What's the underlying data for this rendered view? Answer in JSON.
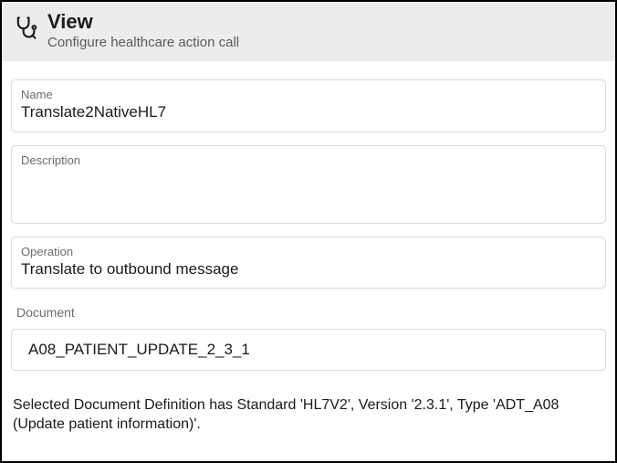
{
  "header": {
    "title": "View",
    "subtitle": "Configure healthcare action call"
  },
  "fields": {
    "name": {
      "label": "Name",
      "value": "Translate2NativeHL7"
    },
    "description": {
      "label": "Description",
      "value": ""
    },
    "operation": {
      "label": "Operation",
      "value": "Translate to outbound message"
    }
  },
  "document": {
    "section_label": "Document",
    "value": "A08_PATIENT_UPDATE_2_3_1"
  },
  "info_text": "Selected Document Definition has Standard 'HL7V2', Version '2.3.1', Type 'ADT_A08 (Update patient information)'."
}
